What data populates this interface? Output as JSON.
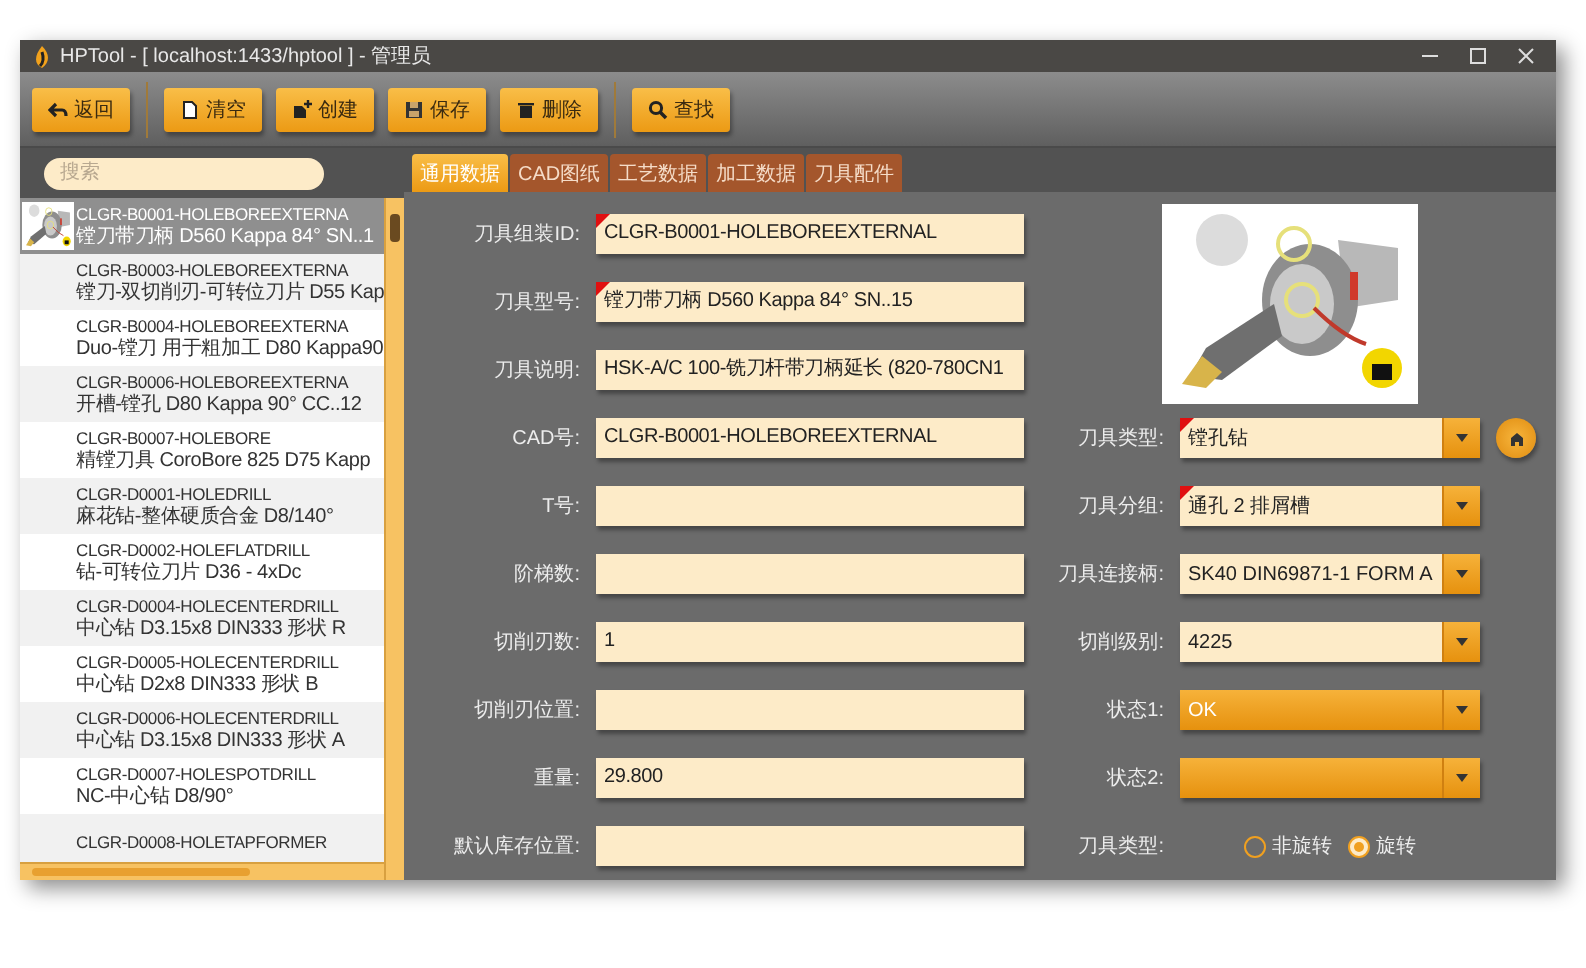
{
  "window": {
    "title": "HPTool - [ localhost:1433/hptool ] - 管理员"
  },
  "toolbar": {
    "groups": [
      [
        {
          "label": "返回",
          "kind": "back"
        }
      ],
      [
        {
          "label": "清空",
          "kind": "clear"
        },
        {
          "label": "创建",
          "kind": "create"
        },
        {
          "label": "保存",
          "kind": "save"
        },
        {
          "label": "删除",
          "kind": "delete"
        }
      ],
      [
        {
          "label": "查找",
          "kind": "search"
        }
      ]
    ]
  },
  "search": {
    "placeholder": "搜索"
  },
  "tabs": [
    {
      "label": "通用数据",
      "selected": true
    },
    {
      "label": "CAD图纸",
      "selected": false
    },
    {
      "label": "工艺数据",
      "selected": false
    },
    {
      "label": "加工数据",
      "selected": false
    },
    {
      "label": "刀具配件",
      "selected": false
    }
  ],
  "tool_list": [
    {
      "code": "CLGR-B0001-HOLEBOREEXTERNA",
      "description": "镗刀带刀柄 D560 Kappa 84° SN..1",
      "selected": true
    },
    {
      "code": "CLGR-B0003-HOLEBOREEXTERNA",
      "description": "镗刀-双切削刃-可转位刀片 D55 Kap",
      "selected": false
    },
    {
      "code": "CLGR-B0004-HOLEBOREEXTERNA",
      "description": "Duo-镗刀 用于粗加工 D80 Kappa90",
      "selected": false
    },
    {
      "code": "CLGR-B0006-HOLEBOREEXTERNA",
      "description": "开槽-镗孔 D80 Kappa 90° CC..12",
      "selected": false
    },
    {
      "code": "CLGR-B0007-HOLEBORE",
      "description": "精镗刀具 CoroBore 825 D75 Kapp",
      "selected": false
    },
    {
      "code": "CLGR-D0001-HOLEDRILL",
      "description": "麻花钻-整体硬质合金 D8/140°",
      "selected": false
    },
    {
      "code": "CLGR-D0002-HOLEFLATDRILL",
      "description": "钻-可转位刀片 D36 - 4xDc",
      "selected": false
    },
    {
      "code": "CLGR-D0004-HOLECENTERDRILL",
      "description": "中心钻 D3.15x8 DIN333 形状 R",
      "selected": false
    },
    {
      "code": "CLGR-D0005-HOLECENTERDRILL",
      "description": "中心钻 D2x8 DIN333 形状 B",
      "selected": false
    },
    {
      "code": "CLGR-D0006-HOLECENTERDRILL",
      "description": "中心钻 D3.15x8 DIN333 形状 A",
      "selected": false
    },
    {
      "code": "CLGR-D0007-HOLESPOTDRILL",
      "description": "NC-中心钻 D8/90°",
      "selected": false
    },
    {
      "code": "CLGR-D0008-HOLETAPFORMER",
      "selected": false
    }
  ],
  "form": {
    "left": [
      {
        "label": "刀具组装ID:",
        "value": "CLGR-B0001-HOLEBOREEXTERNAL",
        "required": true
      },
      {
        "label": "刀具型号:",
        "value": "镗刀带刀柄 D560 Kappa 84° SN..15",
        "required": true
      },
      {
        "label": "刀具说明:",
        "value": "HSK-A/C 100-铣刀杆带刀柄延长 (820-780CN1",
        "required": false
      },
      {
        "label": "CAD号:",
        "value": "CLGR-B0001-HOLEBOREEXTERNAL",
        "required": false
      },
      {
        "label": "T号:",
        "required": false
      },
      {
        "label": "阶梯数:",
        "required": false
      },
      {
        "label": "切削刃数:",
        "value": "1",
        "required": false
      },
      {
        "label": "切削刃位置:",
        "required": false
      },
      {
        "label": "重量:",
        "value": "29.800",
        "required": false
      },
      {
        "label": "默认库存位置:",
        "required": false
      }
    ],
    "right": [
      {
        "kind": "select",
        "label": "刀具类型:",
        "value": "镗孔钻",
        "required": true,
        "highlighted": false,
        "action_button": true
      },
      {
        "kind": "select",
        "label": "刀具分组:",
        "value": "通孔 2 排屑槽",
        "required": true,
        "highlighted": false
      },
      {
        "kind": "select",
        "label": "刀具连接柄:",
        "value": "SK40 DIN69871-1 FORM A",
        "required": false,
        "highlighted": false
      },
      {
        "kind": "select",
        "label": "切削级别:",
        "value": "4225",
        "required": false,
        "highlighted": false
      },
      {
        "kind": "select",
        "label": "状态1:",
        "value": "OK",
        "required": false,
        "highlighted": true
      },
      {
        "kind": "select",
        "label": "状态2:",
        "required": false,
        "highlighted": true
      },
      {
        "kind": "radio",
        "label": "刀具类型:",
        "options": [
          {
            "label": "非旋转",
            "selected": false
          },
          {
            "label": "旋转",
            "selected": true
          }
        ]
      }
    ]
  }
}
